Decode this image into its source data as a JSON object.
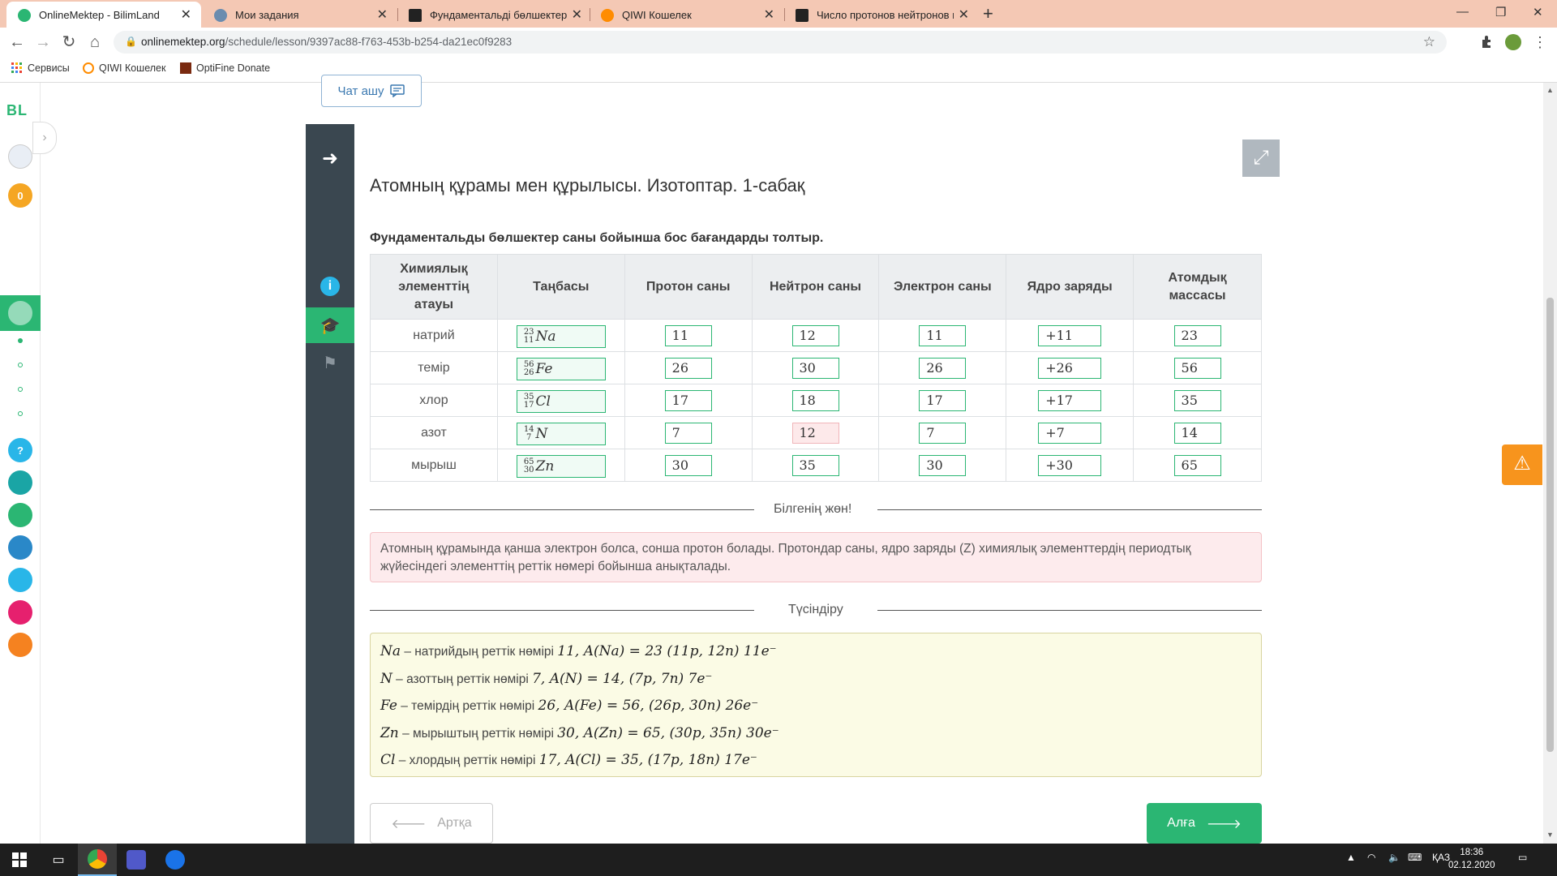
{
  "browser": {
    "tabs": [
      {
        "title": "OnlineMektep - BilimLand",
        "active": true
      },
      {
        "title": "Мои задания",
        "active": false
      },
      {
        "title": "Фундаментальді бөлшектер сан",
        "active": false
      },
      {
        "title": "QIWI Кошелек",
        "active": false
      },
      {
        "title": "Число протонов нейтронов и эл",
        "active": false
      }
    ],
    "new_tab": "+",
    "url_host": "onlinemektep.org",
    "url_path": "/schedule/lesson/9397ac88-f763-453b-b254-da21ec0f9283",
    "bookmarks": [
      "Сервисы",
      "QIWI Кошелек",
      "OptiFine Donate"
    ]
  },
  "rail": {
    "logo": "BL",
    "badge_count": "0",
    "help": "?"
  },
  "chat_button": "Чат ашу",
  "lesson_title": "Атомның құрамы мен құрылысы. Изотоптар. 1-сабақ",
  "task": "Фундаментальды бөлшектер саны бойынша бос бағандарды толтыр.",
  "table": {
    "headers": [
      "Химиялық элементтің атауы",
      "Таңбасы",
      "Протон саны",
      "Нейтрон саны",
      "Электрон саны",
      "Ядро заряды",
      "Атомдық массасы"
    ],
    "rows": [
      {
        "name": "натрий",
        "mass_num": "23",
        "atomic_num": "11",
        "symbol": "Na",
        "protons": "11",
        "neutrons": "12",
        "electrons": "11",
        "charge": "+11",
        "mass": "23",
        "neutrons_wrong": false
      },
      {
        "name": "темір",
        "mass_num": "56",
        "atomic_num": "26",
        "symbol": "Fe",
        "protons": "26",
        "neutrons": "30",
        "electrons": "26",
        "charge": "+26",
        "mass": "56",
        "neutrons_wrong": false
      },
      {
        "name": "хлор",
        "mass_num": "35",
        "atomic_num": "17",
        "symbol": "Cl",
        "protons": "17",
        "neutrons": "18",
        "electrons": "17",
        "charge": "+17",
        "mass": "35",
        "neutrons_wrong": false
      },
      {
        "name": "азот",
        "mass_num": "14",
        "atomic_num": "7",
        "symbol": "N",
        "protons": "7",
        "neutrons": "12",
        "electrons": "7",
        "charge": "+7",
        "mass": "14",
        "neutrons_wrong": true
      },
      {
        "name": "мырыш",
        "mass_num": "65",
        "atomic_num": "30",
        "symbol": "Zn",
        "protons": "30",
        "neutrons": "35",
        "electrons": "30",
        "charge": "+30",
        "mass": "65",
        "neutrons_wrong": false
      }
    ]
  },
  "know_label": "Білгенің жөн!",
  "info_text": "Атомның құрамында қанша электрон болса, сонша протон болады. Протондар саны, ядро заряды (Z) химиялық элементтердің периодтық жүйесіндегі элементтің реттік нөмері бойынша анықталады.",
  "explain_label": "Түсіндіру",
  "explain_lines": [
    {
      "sym": "Na",
      "text": " – натрийдың реттік нөмірі ",
      "formula": "11, A(Na) = 23 (11p, 12n) 11e⁻"
    },
    {
      "sym": "N",
      "text": " – азоттың реттік нөмірі ",
      "formula": "7, A(N) = 14, (7p, 7n) 7e⁻"
    },
    {
      "sym": "Fe",
      "text": " – темірдің реттік нөмірі ",
      "formula": "26, A(Fe) = 56, (26p, 30n) 26e⁻"
    },
    {
      "sym": "Zn",
      "text": " – мырыштың реттік нөмірі ",
      "formula": "30, A(Zn) = 65, (30p, 35n) 30e⁻"
    },
    {
      "sym": "Cl",
      "text": " – хлордың реттік нөмірі ",
      "formula": "17, A(Cl) = 35, (17p, 18n) 17e⁻"
    }
  ],
  "back_button": "Артқа",
  "next_button": "Алға",
  "taskbar": {
    "lang": "ҚАЗ",
    "time": "18:36",
    "date": "02.12.2020"
  },
  "colors": {
    "accent": "#2bb673",
    "tab_bar": "#f4c8b4",
    "side_panel": "#3a4750",
    "warning": "#f7941d"
  }
}
